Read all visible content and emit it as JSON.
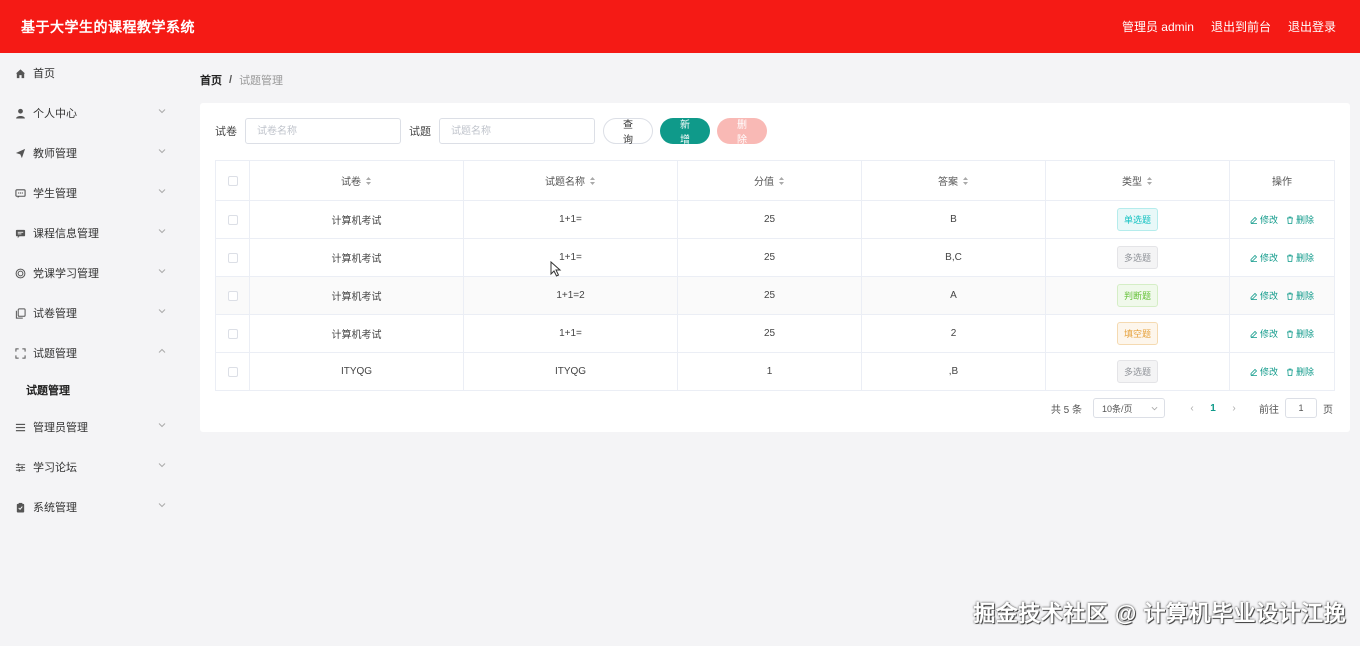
{
  "app": {
    "title": "基于大学生的课程教学系统",
    "user_label": "管理员 admin",
    "link_front": "退出到前台",
    "link_logout": "退出登录"
  },
  "sidebar": {
    "items": [
      {
        "label": "首页",
        "icon": "home-icon",
        "has_arrow": false
      },
      {
        "label": "个人中心",
        "icon": "user-icon",
        "has_arrow": true
      },
      {
        "label": "教师管理",
        "icon": "send-icon",
        "has_arrow": true
      },
      {
        "label": "学生管理",
        "icon": "message-icon",
        "has_arrow": true
      },
      {
        "label": "课程信息管理",
        "icon": "chat-icon",
        "has_arrow": true
      },
      {
        "label": "党课学习管理",
        "icon": "target-icon",
        "has_arrow": true
      },
      {
        "label": "试卷管理",
        "icon": "copy-icon",
        "has_arrow": true
      },
      {
        "label": "试题管理",
        "icon": "fullscreen-icon",
        "has_arrow": true,
        "expanded": true
      },
      {
        "label": "管理员管理",
        "icon": "menu-icon",
        "has_arrow": true
      },
      {
        "label": "学习论坛",
        "icon": "sliders-icon",
        "has_arrow": true
      },
      {
        "label": "系统管理",
        "icon": "clipboard-icon",
        "has_arrow": true
      }
    ],
    "submenu_label": "试题管理"
  },
  "breadcrumb": {
    "home": "首页",
    "sep": "/",
    "current": "试题管理"
  },
  "search": {
    "paper_label": "试卷",
    "paper_placeholder": "试卷名称",
    "question_label": "试题",
    "question_placeholder": "试题名称",
    "query_btn": "查询",
    "add_btn": "新增",
    "delete_btn": "删除"
  },
  "table": {
    "headers": [
      "试卷",
      "试题名称",
      "分值",
      "答案",
      "类型",
      "操作"
    ],
    "rows": [
      {
        "paper": "计算机考试",
        "question": "1+1=",
        "score": "25",
        "answer": "B",
        "type": "单选题",
        "type_style": "teal"
      },
      {
        "paper": "计算机考试",
        "question": "1+1=",
        "score": "25",
        "answer": "B,C",
        "type": "多选题",
        "type_style": "gray"
      },
      {
        "paper": "计算机考试",
        "question": "1+1=2",
        "score": "25",
        "answer": "A",
        "type": "判断题",
        "type_style": "green"
      },
      {
        "paper": "计算机考试",
        "question": "1+1=",
        "score": "25",
        "answer": "2",
        "type": "填空题",
        "type_style": "orange"
      },
      {
        "paper": "ITYQG",
        "question": "ITYQG",
        "score": "1",
        "answer": ",B",
        "type": "多选题",
        "type_style": "gray"
      }
    ],
    "edit_label": "修改",
    "delete_label": "删除"
  },
  "pagination": {
    "total": "共 5 条",
    "page_size": "10条/页",
    "current_page": "1",
    "goto_label": "前往",
    "goto_value": "1",
    "page_suffix": "页"
  },
  "watermark": "掘金技术社区 @ 计算机毕业设计江挽",
  "colors": {
    "topbar": "#f51a15",
    "accent": "#0f9a8a",
    "delete_btn": "#f9b9b5",
    "tag_teal": "#13c2c2",
    "tag_green": "#67c23a",
    "tag_orange": "#e6a23c",
    "tag_gray": "#909399"
  }
}
